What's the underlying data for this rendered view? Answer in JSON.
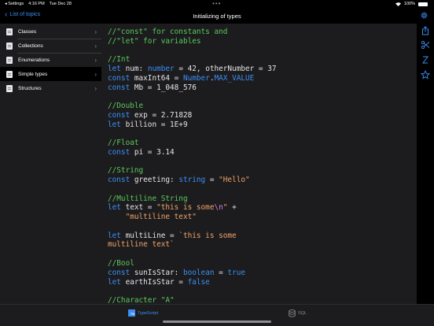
{
  "status": {
    "back_app": "◂ Settings",
    "time": "4:16 PM",
    "date": "Tue Dec 28",
    "battery": "100%"
  },
  "nav": {
    "back_label": "List of topics",
    "title": "Initializing of types"
  },
  "sidebar": {
    "items": [
      {
        "label": "Classes"
      },
      {
        "label": "Collections"
      },
      {
        "label": "Enumerations"
      },
      {
        "label": "Simple types",
        "active": true
      },
      {
        "label": "Structures"
      }
    ]
  },
  "code": {
    "lines": [
      [
        {
          "c": "c",
          "t": "//\"const\" for constants and"
        }
      ],
      [
        {
          "c": "c",
          "t": "//\"let\" for variables"
        }
      ],
      [],
      [
        {
          "c": "c",
          "t": "//Int"
        }
      ],
      [
        {
          "c": "k",
          "t": "let "
        },
        {
          "c": "t",
          "t": "num: "
        },
        {
          "c": "k",
          "t": "number"
        },
        {
          "c": "t",
          "t": " = 42, otherNumber = 37"
        }
      ],
      [
        {
          "c": "k",
          "t": "const "
        },
        {
          "c": "t",
          "t": "maxInt64 = "
        },
        {
          "c": "k",
          "t": "Number"
        },
        {
          "c": "t",
          "t": "."
        },
        {
          "c": "k",
          "t": "MAX_VALUE"
        }
      ],
      [
        {
          "c": "k",
          "t": "const "
        },
        {
          "c": "t",
          "t": "Mb = 1_048_576"
        }
      ],
      [],
      [
        {
          "c": "c",
          "t": "//Double"
        }
      ],
      [
        {
          "c": "k",
          "t": "const "
        },
        {
          "c": "t",
          "t": "exp = 2.71828"
        }
      ],
      [
        {
          "c": "k",
          "t": "let "
        },
        {
          "c": "t",
          "t": "billion = 1E+9"
        }
      ],
      [],
      [
        {
          "c": "c",
          "t": "//Float"
        }
      ],
      [
        {
          "c": "k",
          "t": "const "
        },
        {
          "c": "t",
          "t": "pi = 3.14"
        }
      ],
      [],
      [
        {
          "c": "c",
          "t": "//String"
        }
      ],
      [
        {
          "c": "k",
          "t": "const "
        },
        {
          "c": "t",
          "t": "greeting: "
        },
        {
          "c": "k",
          "t": "string"
        },
        {
          "c": "t",
          "t": " = "
        },
        {
          "c": "s",
          "t": "\"Hello\""
        }
      ],
      [],
      [
        {
          "c": "c",
          "t": "//Multiline String"
        }
      ],
      [
        {
          "c": "k",
          "t": "let "
        },
        {
          "c": "t",
          "t": "text = "
        },
        {
          "c": "s",
          "t": "\"this is some"
        },
        {
          "c": "e",
          "t": "\\n"
        },
        {
          "c": "s",
          "t": "\""
        },
        {
          "c": "t",
          "t": " +"
        }
      ],
      [
        {
          "c": "t",
          "t": "    "
        },
        {
          "c": "s",
          "t": "\"multiline text\""
        }
      ],
      [],
      [
        {
          "c": "k",
          "t": "let "
        },
        {
          "c": "t",
          "t": "multiLine = "
        },
        {
          "c": "s",
          "t": "`this is some"
        }
      ],
      [
        {
          "c": "s",
          "t": "multiline text`"
        }
      ],
      [],
      [
        {
          "c": "c",
          "t": "//Bool"
        }
      ],
      [
        {
          "c": "k",
          "t": "const "
        },
        {
          "c": "t",
          "t": "sunIsStar: "
        },
        {
          "c": "k",
          "t": "boolean"
        },
        {
          "c": "t",
          "t": " = "
        },
        {
          "c": "k",
          "t": "true"
        }
      ],
      [
        {
          "c": "k",
          "t": "let "
        },
        {
          "c": "t",
          "t": "earthIsStar = "
        },
        {
          "c": "k",
          "t": "false"
        }
      ],
      [],
      [
        {
          "c": "c",
          "t": "//Character \"A\""
        }
      ]
    ]
  },
  "tabs": {
    "typescript": "TypeScript",
    "sql": "SQL"
  },
  "colors": {
    "accent": "#3b8ef3",
    "comment": "#5ac85a",
    "string": "#f0a36a"
  }
}
